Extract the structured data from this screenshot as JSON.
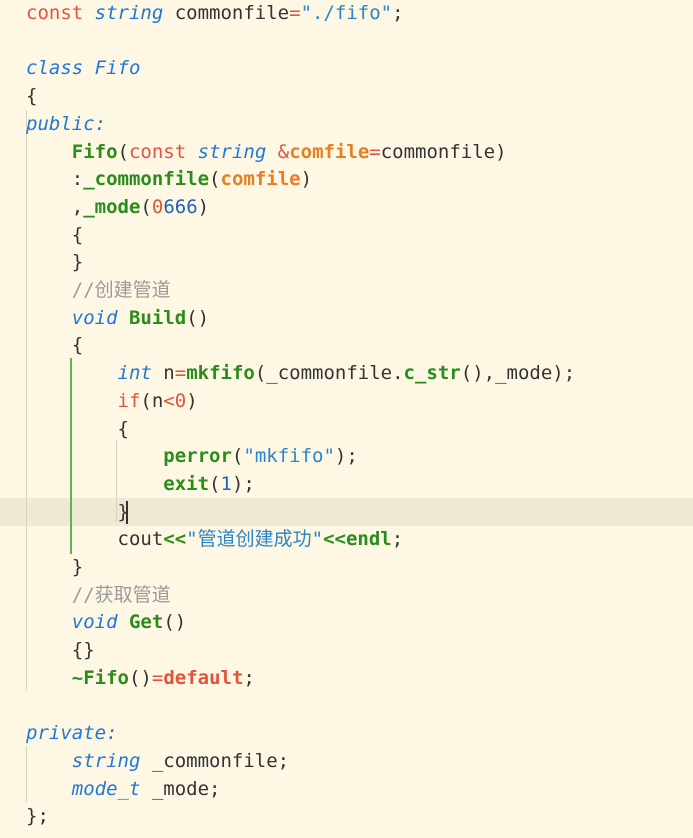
{
  "code_editor": {
    "lines": [
      [
        {
          "t": "const",
          "c": "kw"
        },
        {
          "t": " "
        },
        {
          "t": "string",
          "c": "type"
        },
        {
          "t": " commonfile"
        },
        {
          "t": "=",
          "c": "op"
        },
        {
          "t": "\"./fifo\"",
          "c": "str"
        },
        {
          "t": ";"
        }
      ],
      [],
      [
        {
          "t": "class",
          "c": "type"
        },
        {
          "t": " "
        },
        {
          "t": "Fifo",
          "c": "type"
        }
      ],
      [
        {
          "t": "{"
        }
      ],
      [
        {
          "t": "public:",
          "c": "type"
        }
      ],
      [
        {
          "t": "    "
        },
        {
          "t": "Fifo",
          "c": "fn"
        },
        {
          "t": "("
        },
        {
          "t": "const",
          "c": "kw"
        },
        {
          "t": " "
        },
        {
          "t": "string",
          "c": "type"
        },
        {
          "t": " "
        },
        {
          "t": "&",
          "c": "op"
        },
        {
          "t": "comfile",
          "c": "param"
        },
        {
          "t": "=",
          "c": "op"
        },
        {
          "t": "commonfile)"
        }
      ],
      [
        {
          "t": "    :"
        },
        {
          "t": "_commonfile",
          "c": "fn"
        },
        {
          "t": "("
        },
        {
          "t": "comfile",
          "c": "param"
        },
        {
          "t": ")"
        }
      ],
      [
        {
          "t": "    ,"
        },
        {
          "t": "_mode",
          "c": "fn"
        },
        {
          "t": "("
        },
        {
          "t": "0",
          "c": "numred"
        },
        {
          "t": "666",
          "c": "num"
        },
        {
          "t": ")"
        }
      ],
      [
        {
          "t": "    {"
        }
      ],
      [
        {
          "t": "    }"
        }
      ],
      [
        {
          "t": "    "
        },
        {
          "t": "//创建管道",
          "c": "comment"
        }
      ],
      [
        {
          "t": "    "
        },
        {
          "t": "void",
          "c": "type"
        },
        {
          "t": " "
        },
        {
          "t": "Build",
          "c": "fn"
        },
        {
          "t": "()"
        }
      ],
      [
        {
          "t": "    {"
        }
      ],
      [
        {
          "t": "        "
        },
        {
          "t": "int",
          "c": "type"
        },
        {
          "t": " n"
        },
        {
          "t": "=",
          "c": "op"
        },
        {
          "t": "mkfifo",
          "c": "fn"
        },
        {
          "t": "(_commonfile."
        },
        {
          "t": "c_str",
          "c": "fn"
        },
        {
          "t": "(),_mode);"
        }
      ],
      [
        {
          "t": "        "
        },
        {
          "t": "if",
          "c": "kw"
        },
        {
          "t": "(n"
        },
        {
          "t": "<",
          "c": "op"
        },
        {
          "t": "0",
          "c": "numred"
        },
        {
          "t": ")"
        }
      ],
      [
        {
          "t": "        {"
        }
      ],
      [
        {
          "t": "            "
        },
        {
          "t": "perror",
          "c": "fn"
        },
        {
          "t": "("
        },
        {
          "t": "\"mkfifo\"",
          "c": "str"
        },
        {
          "t": ");"
        }
      ],
      [
        {
          "t": "            "
        },
        {
          "t": "exit",
          "c": "fn"
        },
        {
          "t": "("
        },
        {
          "t": "1",
          "c": "num"
        },
        {
          "t": ");"
        }
      ],
      [
        {
          "t": "        }"
        }
      ],
      [
        {
          "t": "        cout"
        },
        {
          "t": "<<",
          "c": "fn"
        },
        {
          "t": "\"管道创建成功\"",
          "c": "str"
        },
        {
          "t": "<<",
          "c": "fn"
        },
        {
          "t": "endl",
          "c": "fn"
        },
        {
          "t": ";"
        }
      ],
      [
        {
          "t": "    }"
        }
      ],
      [
        {
          "t": "    "
        },
        {
          "t": "//获取管道",
          "c": "comment"
        }
      ],
      [
        {
          "t": "    "
        },
        {
          "t": "void",
          "c": "type"
        },
        {
          "t": " "
        },
        {
          "t": "Get",
          "c": "fn"
        },
        {
          "t": "()"
        }
      ],
      [
        {
          "t": "    {}"
        }
      ],
      [
        {
          "t": "    "
        },
        {
          "t": "~Fifo",
          "c": "fn"
        },
        {
          "t": "()"
        },
        {
          "t": "=",
          "c": "op"
        },
        {
          "t": "default",
          "c": "redbold"
        },
        {
          "t": ";"
        }
      ],
      [],
      [
        {
          "t": "private:",
          "c": "type"
        }
      ],
      [
        {
          "t": "    "
        },
        {
          "t": "string",
          "c": "type"
        },
        {
          "t": " _commonfile;"
        }
      ],
      [
        {
          "t": "    "
        },
        {
          "t": "mode_t",
          "c": "type"
        },
        {
          "t": " _mode;"
        }
      ],
      [
        {
          "t": "};"
        }
      ]
    ]
  },
  "colors": {
    "background": "#fdf7e3",
    "current_line": "#eee8d4",
    "active_guide": "#59b74e"
  }
}
